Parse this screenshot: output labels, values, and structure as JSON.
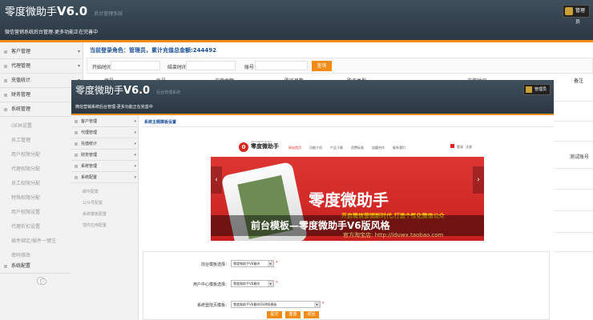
{
  "back_window": {
    "logo": "零度微助手",
    "version": "V6.0",
    "tagline": "后台管理系统",
    "user": "管理员",
    "notice": "微信营销系统后台管理-更多功能正在完善中",
    "sidebar": [
      {
        "label": "客户管理"
      },
      {
        "label": "代理管理"
      },
      {
        "label": "充值统计"
      },
      {
        "label": "财务管理"
      },
      {
        "label": "系统管理"
      }
    ],
    "sidebar_sub": [
      "OEM设置",
      "员工管理",
      "用户权限分配",
      "代理权限分配",
      "员工权限分配",
      "特殊权限分配",
      "用户权限设置",
      "代理折扣设置",
      "插件绑定/插件一键注",
      "密码修改"
    ],
    "sidebar_extra": "系统配置",
    "current_role": "当前登录角色：管理员，累计充值总金额:244492",
    "filters": {
      "start": "开始时间",
      "end": "结束时间",
      "account": "账号",
      "query": "查询"
    },
    "columns": [
      "序号",
      "账号",
      "充值金额",
      "购买月数",
      "购买类型",
      "充值时间",
      "备注"
    ],
    "test_account": "测试账号"
  },
  "front_window": {
    "logo": "零度微助手",
    "version": "V6.0",
    "tagline": "后台管理系统",
    "user": "管理员",
    "notice": "微信营销系统后台管理-更多功能正在完善中",
    "sidebar": [
      {
        "label": "客户管理"
      },
      {
        "label": "代理管理"
      },
      {
        "label": "充值统计"
      },
      {
        "label": "财务管理"
      },
      {
        "label": "系统管理"
      },
      {
        "label": "系统配置"
      }
    ],
    "sidebar_sub": [
      "邮件配置",
      "公众号配置",
      "系统模板配置",
      "插件应用配置"
    ],
    "page_title": "系统主题模板设置",
    "banner": {
      "logo_small": "WEIXINZHUSHOU",
      "logo_text": "零度微助手",
      "logo_mark": "0",
      "menu": [
        "网站首页",
        "功能介绍",
        "产品下载",
        "资费标准",
        "加盟合作",
        "联系我们"
      ],
      "active_index": 0,
      "login": "登录",
      "register": "注册",
      "big_text": "零度微助手",
      "slogan": "开启微信营销新时代,打造个性化微信公众",
      "caption": "前台模板—零度微助手V6版风格",
      "watermark": "官方淘宝店: http://lduwx.taobao.com"
    },
    "form": {
      "rows": [
        {
          "label": "前台模板选择：",
          "value": "零度微助手V6最终"
        },
        {
          "label": "用户中心模板选择：",
          "value": "零度微助手V6最终"
        },
        {
          "label": "系统登陆页模板：",
          "value": "零度微助手V6最终OEM版模板"
        }
      ],
      "buttons": [
        "提交",
        "重置",
        "返回"
      ]
    }
  },
  "colors": {
    "accent": "#f18c16",
    "header": "#34424e",
    "title_blue": "#1a4e9a",
    "banner_red": "#d9271f"
  }
}
